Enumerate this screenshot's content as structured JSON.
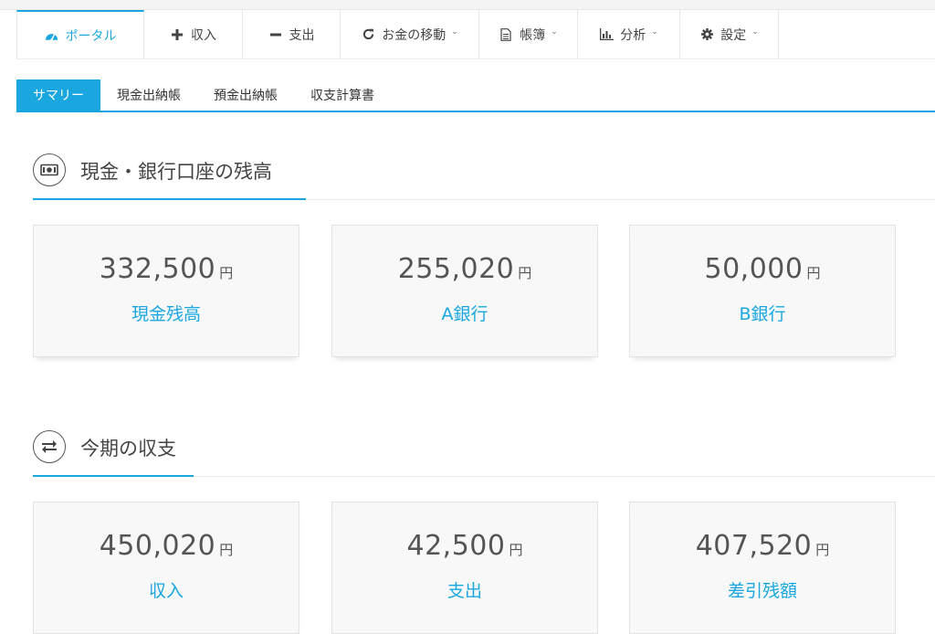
{
  "nav": {
    "items": [
      {
        "label": "ポータル",
        "icon": "dashboard-icon",
        "has_dropdown": false,
        "active": true
      },
      {
        "label": "収入",
        "icon": "plus-icon",
        "has_dropdown": false
      },
      {
        "label": "支出",
        "icon": "minus-icon",
        "has_dropdown": false
      },
      {
        "label": "お金の移動",
        "icon": "refresh-icon",
        "has_dropdown": true
      },
      {
        "label": "帳簿",
        "icon": "document-icon",
        "has_dropdown": true
      },
      {
        "label": "分析",
        "icon": "bar-chart-icon",
        "has_dropdown": true
      },
      {
        "label": "設定",
        "icon": "gear-icon",
        "has_dropdown": true
      }
    ],
    "accent_color": "#1aa7e0"
  },
  "subtabs": [
    {
      "label": "サマリー",
      "active": true
    },
    {
      "label": "現金出納帳"
    },
    {
      "label": "預金出納帳"
    },
    {
      "label": "収支計算書"
    }
  ],
  "sections": {
    "balances": {
      "title": "現金・銀行口座の残高",
      "icon": "money-icon",
      "cards": [
        {
          "amount": "332,500",
          "unit": "円",
          "label": "現金残高"
        },
        {
          "amount": "255,020",
          "unit": "円",
          "label": "A銀行"
        },
        {
          "amount": "50,000",
          "unit": "円",
          "label": "B銀行"
        }
      ]
    },
    "period": {
      "title": "今期の収支",
      "icon": "exchange-icon",
      "cards": [
        {
          "amount": "450,020",
          "unit": "円",
          "label": "収入"
        },
        {
          "amount": "42,500",
          "unit": "円",
          "label": "支出"
        },
        {
          "amount": "407,520",
          "unit": "円",
          "label": "差引残額"
        }
      ]
    }
  }
}
